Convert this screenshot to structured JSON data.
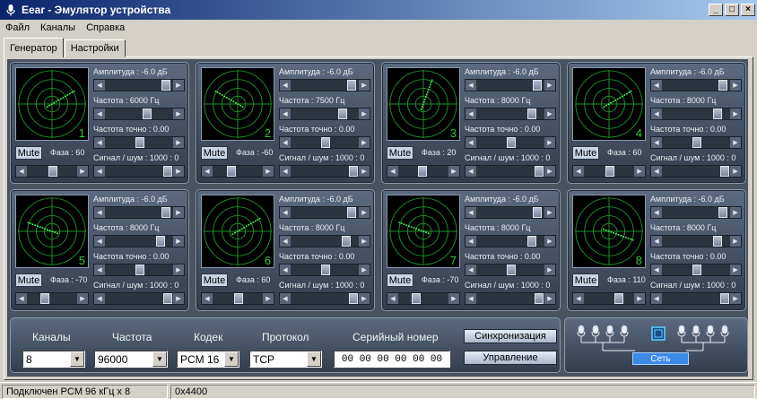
{
  "window": {
    "title": "Eear - Эмулятор устройства",
    "minimize": "_",
    "maximize": "□",
    "close": "×"
  },
  "menu": [
    "Файл",
    "Каналы",
    "Справка"
  ],
  "tabs": [
    {
      "label": "Генератор",
      "active": true
    },
    {
      "label": "Настройки",
      "active": false
    }
  ],
  "mute_label": "Mute",
  "channels": [
    {
      "num": "1",
      "amp": "Амплитуда : -6.0 дБ",
      "freq": "Частота : 6000 Гц",
      "fine": "Частота точно : 0.00",
      "snr": "Сигнал / шум : 1000 : 0",
      "phase": "Фаза : 60",
      "amp_level": 0.92,
      "freq_level": 0.62,
      "fine_level": 0.5,
      "snr_level": 0.96,
      "phase_level": 0.5,
      "angle": 60
    },
    {
      "num": "2",
      "amp": "Амплитуда : -6.0 дБ",
      "freq": "Частота : 7500 Гц",
      "fine": "Частота точно : 0.00",
      "snr": "Сигнал / шум : 1000 : 0",
      "phase": "Фаза : -60",
      "amp_level": 0.92,
      "freq_level": 0.78,
      "fine_level": 0.5,
      "snr_level": 0.96,
      "phase_level": 0.33,
      "angle": -60
    },
    {
      "num": "3",
      "amp": "Амплитуда : -6.0 дБ",
      "freq": "Частота : 8000 Гц",
      "fine": "Частота точно : 0.00",
      "snr": "Сигнал / шум : 1000 : 0",
      "phase": "Фаза : 20",
      "amp_level": 0.92,
      "freq_level": 0.84,
      "fine_level": 0.5,
      "snr_level": 0.96,
      "phase_level": 0.45,
      "angle": 20
    },
    {
      "num": "4",
      "amp": "Амплитуда : -6.0 дБ",
      "freq": "Частота : 8000 Гц",
      "fine": "Частота точно : 0.00",
      "snr": "Сигнал / шум : 1000 : 0",
      "phase": "Фаза : 60",
      "amp_level": 0.92,
      "freq_level": 0.84,
      "fine_level": 0.5,
      "snr_level": 0.96,
      "phase_level": 0.5,
      "angle": 60
    },
    {
      "num": "5",
      "amp": "Амплитуда : -6.0 дБ",
      "freq": "Частота : 8000 Гц",
      "fine": "Частота точно : 0.00",
      "snr": "Сигнал / шум : 1000 : 0",
      "phase": "Фаза : -70",
      "amp_level": 0.92,
      "freq_level": 0.84,
      "fine_level": 0.5,
      "snr_level": 0.96,
      "phase_level": 0.32,
      "angle": -70
    },
    {
      "num": "6",
      "amp": "Амплитуда : -6.0 дБ",
      "freq": "Частота : 8000 Гц",
      "fine": "Частота точно : 0.00",
      "snr": "Сигнал / шум : 1000 : 0",
      "phase": "Фаза : 60",
      "amp_level": 0.92,
      "freq_level": 0.84,
      "fine_level": 0.5,
      "snr_level": 0.96,
      "phase_level": 0.5,
      "angle": 60
    },
    {
      "num": "7",
      "amp": "Амплитуда : -6.0 дБ",
      "freq": "Частота : 8000 Гц",
      "fine": "Частота точно : 0.00",
      "snr": "Сигнал / шум : 1000 : 0",
      "phase": "Фаза : -70",
      "amp_level": 0.92,
      "freq_level": 0.84,
      "fine_level": 0.5,
      "snr_level": 0.96,
      "phase_level": 0.32,
      "angle": -70
    },
    {
      "num": "8",
      "amp": "Амплитуда : -6.0 дБ",
      "freq": "Частота : 8000 Гц",
      "fine": "Частота точно : 0.00",
      "snr": "Сигнал / шум : 1000 : 0",
      "phase": "Фаза : 110",
      "amp_level": 0.92,
      "freq_level": 0.84,
      "fine_level": 0.5,
      "snr_level": 0.96,
      "phase_level": 0.7,
      "angle": 110
    }
  ],
  "bottom": {
    "channels_label": "Каналы",
    "channels_value": "8",
    "freq_label": "Частота",
    "freq_value": "96000",
    "codec_label": "Кодек",
    "codec_value": "PCM 16",
    "protocol_label": "Протокол",
    "protocol_value": "TCP",
    "serial_label": "Серийный номер",
    "serial_value": "00 00 00 00 00 00",
    "sync_button": "Синхронизация",
    "control_button": "Управление"
  },
  "network": {
    "button": "Сеть"
  },
  "status": {
    "left": "Подключен PCM 96 кГц x 8",
    "right": "0x4400"
  },
  "colors": {
    "panel": "#46536a",
    "scope_grid": "#1f8f2a",
    "scope_trace": "#4ef060",
    "net_button": "#3a8ae6"
  }
}
